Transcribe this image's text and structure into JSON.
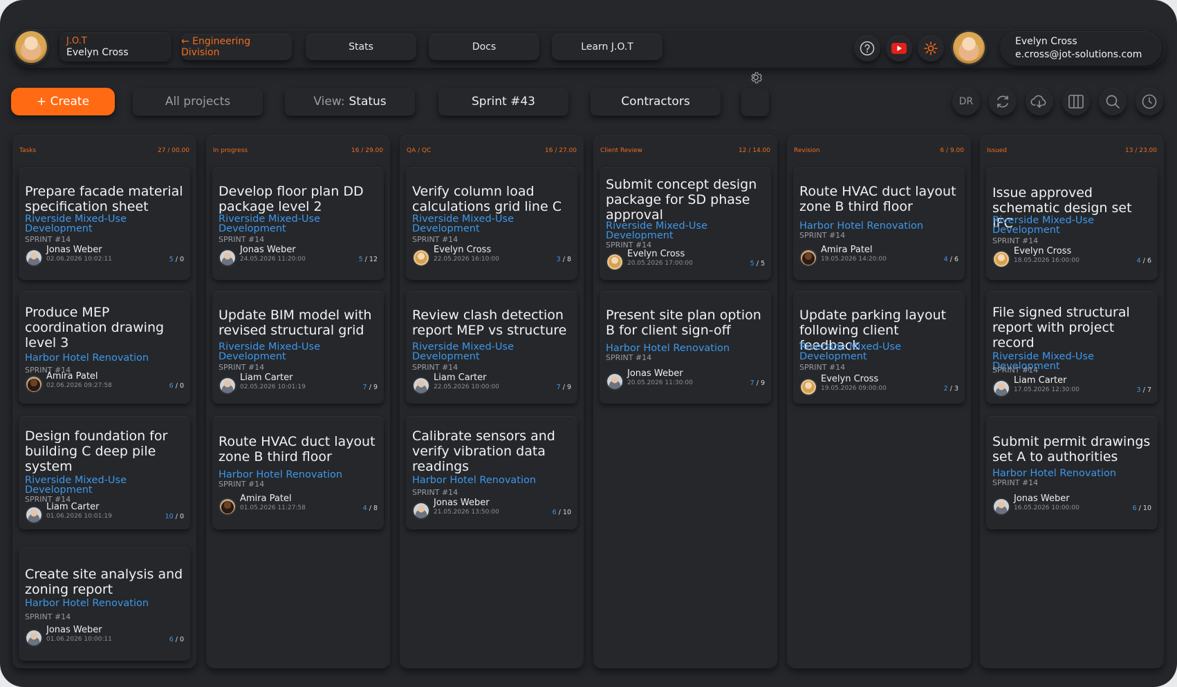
{
  "header": {
    "brand": "J.O.T",
    "user_name": "Evelyn Cross",
    "division_link": "← Engineering Division",
    "nav": [
      "Stats",
      "Docs",
      "Learn J.O.T"
    ],
    "account_name": "Evelyn Cross",
    "account_email": "e.cross@jot-solutions.com",
    "icons": [
      "help-icon",
      "youtube-icon",
      "sun-icon"
    ]
  },
  "toolbar": {
    "create_label": "+ Create",
    "projects_label": "All projects",
    "view_prefix": "View:",
    "view_value": "Status",
    "sprint_label": "Sprint #43",
    "contractors_label": "Contractors",
    "initials": "DR",
    "icons": [
      "refresh-icon",
      "cloud-download-icon",
      "columns-icon",
      "search-icon",
      "clock-icon"
    ]
  },
  "colors": {
    "accent": "#ff6a13",
    "link": "#3f97e8",
    "bg": "#25272b"
  },
  "columns": [
    {
      "name": "Tasks",
      "count": "27 / 00.00",
      "cards": [
        {
          "title": "Prepare facade material specification sheet",
          "project": "Riverside Mixed-Use Development",
          "sprint": "SPRINT #14",
          "user": "Jonas Weber",
          "date": "02.06.2026 10:02:11",
          "done": "5",
          "total": " / 0"
        },
        {
          "title": "Produce MEP coordination drawing level 3",
          "project": "Harbor Hotel Renovation",
          "sprint": "SPRINT #14",
          "user": "Amira Patel",
          "date": "02.06.2026 09:27:58",
          "done": "6",
          "total": " / 0"
        },
        {
          "title": "Design foundation for building C deep pile system",
          "project": "Riverside Mixed-Use Development",
          "sprint": "SPRINT #14",
          "user": "Liam Carter",
          "date": "01.06.2026 10:01:19",
          "done": "10",
          "total": " / 0"
        },
        {
          "title": "Create site analysis and zoning report",
          "project": "Harbor Hotel Renovation",
          "sprint": "SPRINT #14",
          "user": "Jonas Weber",
          "date": "01.06.2026 10:00:11",
          "done": "6",
          "total": " / 0"
        }
      ]
    },
    {
      "name": "In progress",
      "count": "16 / 29.00",
      "cards": [
        {
          "title": "Develop floor plan DD package level 2",
          "project": "Riverside Mixed-Use Development",
          "sprint": "SPRINT #14",
          "user": "Jonas Weber",
          "date": "24.05.2026 11:20:00",
          "done": "5",
          "total": " / 12"
        },
        {
          "title": "Update BIM model with revised structural grid",
          "project": "Riverside Mixed-Use Development",
          "sprint": "SPRINT #14",
          "user": "Liam Carter",
          "date": "02.05.2026 10:01:19",
          "done": "7",
          "total": " / 9"
        },
        {
          "title": "Route HVAC duct layout zone B third floor",
          "project": "Harbor Hotel Renovation",
          "sprint": "SPRINT #14",
          "user": "Amira Patel",
          "date": "01.05.2026 11:27:58",
          "done": "4",
          "total": " / 8"
        }
      ]
    },
    {
      "name": "QA / QC",
      "count": "16 / 27.00",
      "cards": [
        {
          "title": "Verify column load calculations grid line C",
          "project": "Riverside Mixed-Use Development",
          "sprint": "SPRINT #14",
          "user": "Evelyn Cross",
          "date": "22.05.2026 16:10:00",
          "done": "3",
          "total": " / 8"
        },
        {
          "title": "Review clash detection report MEP vs structure",
          "project": "Riverside Mixed-Use Development",
          "sprint": "SPRINT #14",
          "user": "Liam Carter",
          "date": "22.05.2026 10:00:00",
          "done": "7",
          "total": " / 9"
        },
        {
          "title": "Calibrate sensors and verify vibration data readings",
          "project": "Harbor Hotel Renovation",
          "sprint": "SPRINT #14",
          "user": "Jonas Weber",
          "date": "21.05.2026 13:50:00",
          "done": "6",
          "total": " / 10"
        }
      ]
    },
    {
      "name": "Client Review",
      "count": "12 / 14.00",
      "cards": [
        {
          "title": "Submit concept design package for SD phase approval",
          "project": "Riverside Mixed-Use Development",
          "sprint": "SPRINT #14",
          "user": "Evelyn Cross",
          "date": "20.05.2026 17:00:00",
          "done": "5",
          "total": " / 5"
        },
        {
          "title": "Present site plan option B for client sign-off",
          "project": "Harbor Hotel Renovation",
          "sprint": "SPRINT #14",
          "user": "Jonas Weber",
          "date": "20.05.2026 11:30:00",
          "done": "7",
          "total": " / 9"
        }
      ]
    },
    {
      "name": "Revision",
      "count": "6 / 9.00",
      "cards": [
        {
          "title": "Route HVAC duct layout zone B third floor",
          "project": "Harbor Hotel Renovation",
          "sprint": "SPRINT #14",
          "user": "Amira Patel",
          "date": "19.05.2026 14:20:00",
          "done": "4",
          "total": " / 6"
        },
        {
          "title": "Update parking layout following client feedback",
          "project": "Riverside Mixed-Use Development",
          "sprint": "SPRINT #14",
          "user": "Evelyn Cross",
          "date": "19.05.2026 09:00:00",
          "done": "2",
          "total": " / 3"
        }
      ]
    },
    {
      "name": "Issued",
      "count": "13 / 23.00",
      "cards": [
        {
          "title": "Issue approved schematic design set IFC",
          "project": "Riverside Mixed-Use Development",
          "sprint": "SPRINT #14",
          "user": "Evelyn Cross",
          "date": "18.05.2026 16:00:00",
          "done": "4",
          "total": " / 6"
        },
        {
          "title": "File signed structural report with project record",
          "project": "Riverside Mixed-Use Development",
          "sprint": "SPRINT #14",
          "user": "Liam Carter",
          "date": "17.05.2026 12:30:00",
          "done": "3",
          "total": " / 7"
        },
        {
          "title": "Submit permit drawings set A to authorities",
          "project": "Harbor Hotel Renovation",
          "sprint": "SPRINT #14",
          "user": "Jonas Weber",
          "date": "16.05.2026 10:00:00",
          "done": "6",
          "total": " / 10"
        }
      ]
    }
  ]
}
